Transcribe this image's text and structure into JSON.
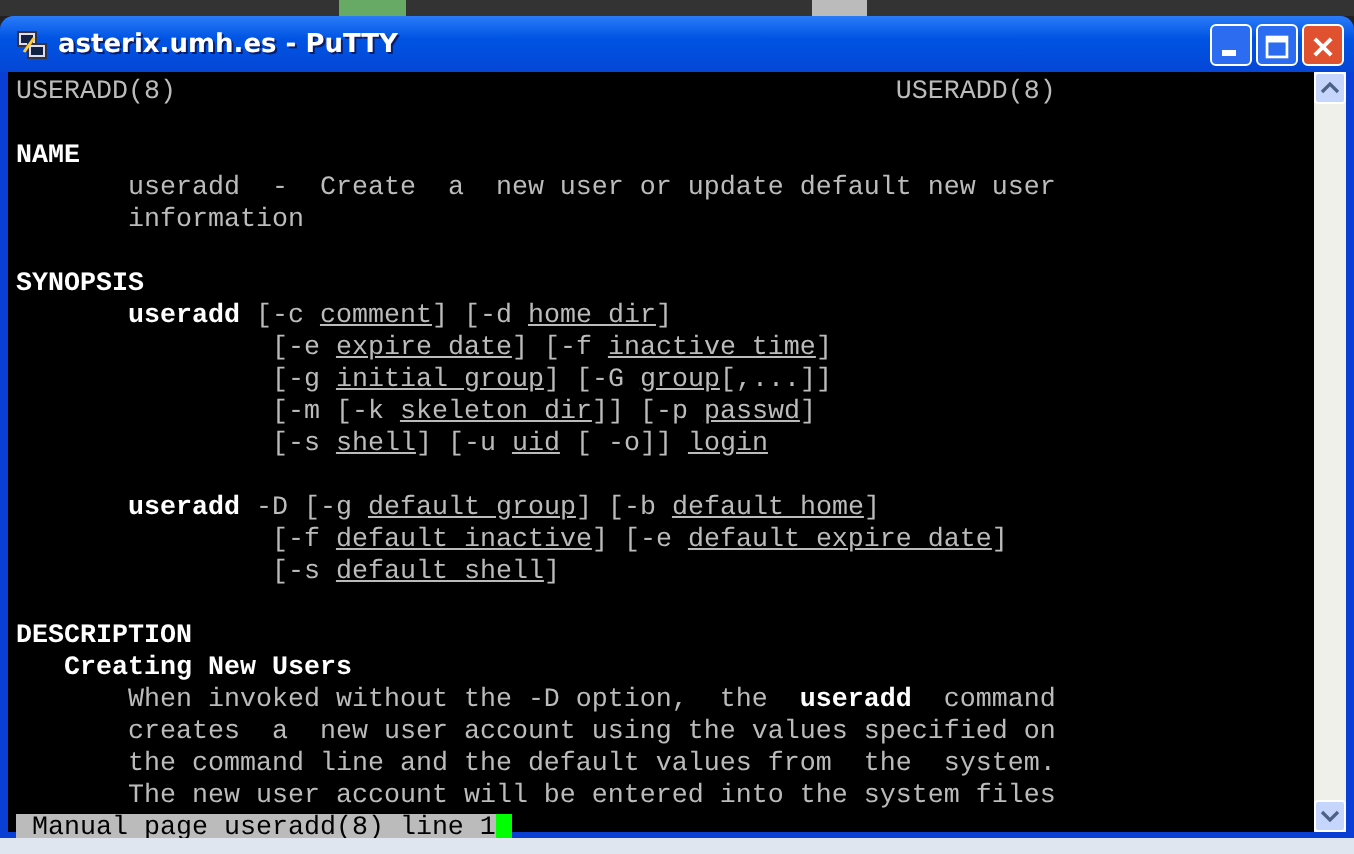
{
  "window": {
    "title": "asterix.umh.es - PuTTY"
  },
  "header": {
    "left": "USERADD(8)",
    "right": "USERADD(8)"
  },
  "lines": [
    {
      "kind": "blank"
    },
    {
      "kind": "heading",
      "text": "NAME"
    },
    {
      "kind": "body",
      "text": "useradd  -  Create  a  new user or update default new user"
    },
    {
      "kind": "body",
      "text": "information"
    },
    {
      "kind": "blank"
    },
    {
      "kind": "heading",
      "text": "SYNOPSIS"
    },
    {
      "kind": "body",
      "text": "**useradd** [-c *comment*] [-d *home dir*]"
    },
    {
      "kind": "option",
      "text": "[-e *expire date*] [-f *inactive time*]"
    },
    {
      "kind": "option",
      "text": "[-g *initial group*] [-G *group*[,...]]"
    },
    {
      "kind": "option",
      "text": "[-m [-k *skeleton dir*]] [-p *passwd*]"
    },
    {
      "kind": "option",
      "text": "[-s *shell*] [-u *uid* [ -o]] *login*"
    },
    {
      "kind": "blank"
    },
    {
      "kind": "body",
      "text": "**useradd** -D [-g *default group*] [-b *default home*]"
    },
    {
      "kind": "option",
      "text": "[-f *default inactive*] [-e *default expire date*]"
    },
    {
      "kind": "option",
      "text": "[-s *default shell*]"
    },
    {
      "kind": "blank"
    },
    {
      "kind": "heading",
      "text": "DESCRIPTION"
    },
    {
      "kind": "subheading",
      "text": "Creating New Users"
    },
    {
      "kind": "body",
      "text": "When invoked without the -D option,  the  **useradd**  command"
    },
    {
      "kind": "body",
      "text": "creates  a  new user account using the values specified on"
    },
    {
      "kind": "body",
      "text": "the command line and the default values from  the  system."
    },
    {
      "kind": "body",
      "text": "The new user account will be entered into the system files"
    }
  ],
  "status_bar": {
    "text": "Manual page useradd(8) line 1"
  }
}
